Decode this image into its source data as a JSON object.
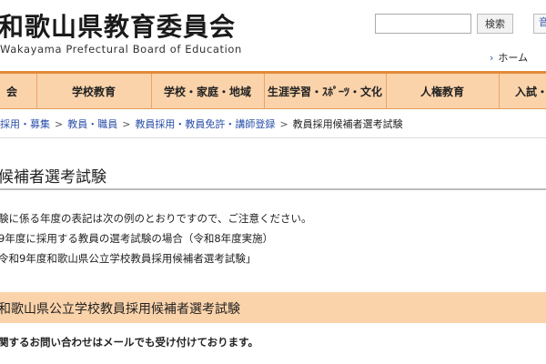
{
  "header": {
    "site_title": "和歌山県教育委員会",
    "site_subtitle": "Wakayama Prefectural Board of Education",
    "search_button": "検索",
    "top_right_link": "音",
    "home_link": "ホーム"
  },
  "nav": {
    "items": [
      {
        "label": "会"
      },
      {
        "label": "学校教育"
      },
      {
        "label": "学校・家庭・地域"
      },
      {
        "label": "生涯学習・ｽﾎﾟｰﾂ・文化"
      },
      {
        "label": "人権教育"
      },
      {
        "label": "入試・"
      }
    ]
  },
  "breadcrumb": {
    "items": [
      {
        "label": "採用・募集"
      },
      {
        "label": "教員・職員"
      },
      {
        "label": "教員採用・教員免許・講師登録"
      }
    ],
    "current": "教員採用候補者選考試験"
  },
  "main": {
    "page_title": "候補者選考試験",
    "paragraphs": [
      "験に係る年度の表記は次の例のとおりですので、ご注意ください。",
      "9年度に採用する教員の選考試験の場合（令和8年度実施）",
      "令和9年度和歌山県公立学校教員採用候補者選考試験」"
    ],
    "section_heading": "和歌山県公立学校教員採用候補者選考試験",
    "notice": "関するお問い合わせはメールでも受け付けております。"
  }
}
